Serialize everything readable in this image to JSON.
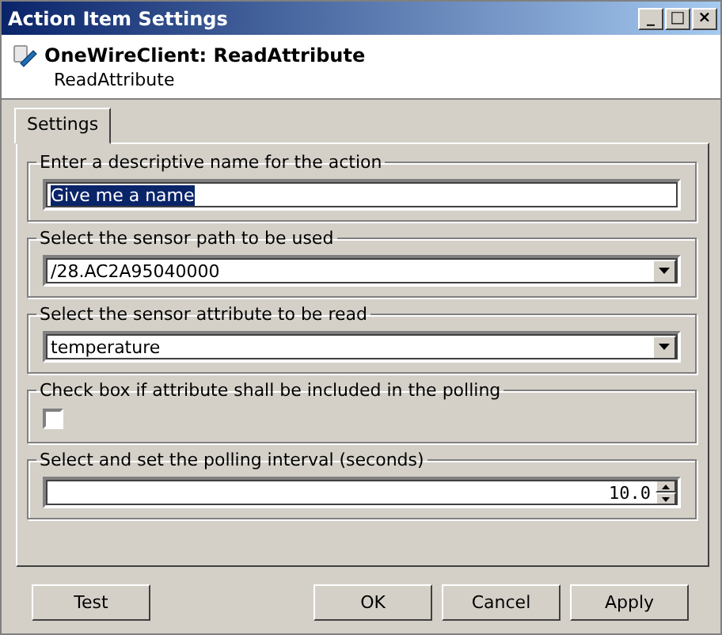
{
  "window": {
    "title": "Action Item Settings",
    "controls": [
      "_",
      "□",
      "×"
    ]
  },
  "header": {
    "title": "OneWireClient: ReadAttribute",
    "subtitle": "ReadAttribute"
  },
  "tabs": [
    {
      "label": "Settings",
      "selected": true
    }
  ],
  "groups": [
    {
      "kind": "text",
      "legend": "Enter a descriptive name for the action",
      "value": "Give me a name",
      "highlighted": true
    },
    {
      "kind": "combo",
      "legend": "Select the sensor path to be used",
      "value": "/28.AC2A95040000"
    },
    {
      "kind": "combo",
      "legend": "Select the sensor attribute to be read",
      "value": "temperature"
    },
    {
      "kind": "checkbox",
      "legend": "Check box if attribute shall be included in the polling",
      "checked": false
    },
    {
      "kind": "spinner",
      "legend": "Select and set the polling interval (seconds)",
      "value": "10.0"
    }
  ],
  "buttons_left": [
    "Test"
  ],
  "buttons_right": [
    "OK",
    "Cancel",
    "Apply"
  ]
}
